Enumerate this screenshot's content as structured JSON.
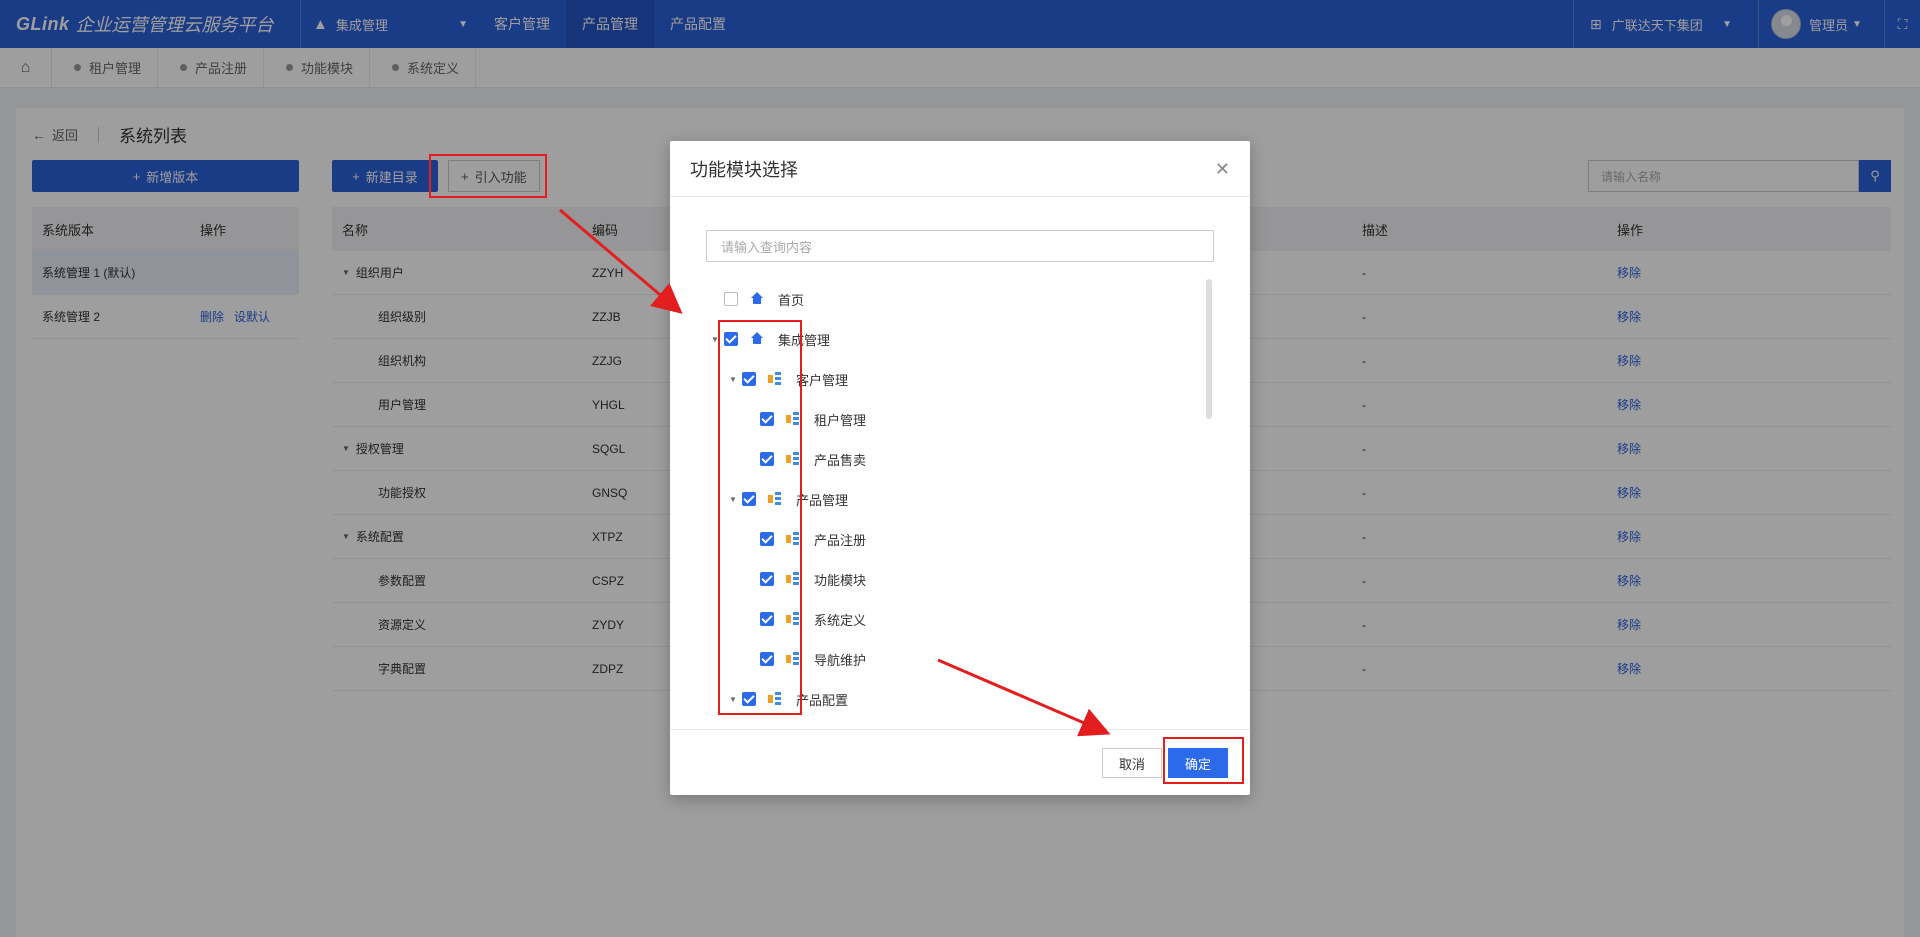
{
  "topbar": {
    "brand": "GLink",
    "title": "企业运营管理云服务平台",
    "system_menu": "集成管理",
    "tabs": [
      "客户管理",
      "产品管理",
      "产品配置"
    ],
    "org": "广联达天下集团",
    "user": "管理员"
  },
  "breadcrumbs": [
    "租户管理",
    "产品注册",
    "功能模块",
    "系统定义"
  ],
  "page": {
    "back": "返回",
    "title": "系统列表"
  },
  "left": {
    "add_version": "新增版本",
    "headers": [
      "系统版本",
      "操作"
    ],
    "rows": [
      {
        "name": "系统管理 1 (默认)",
        "actions": []
      },
      {
        "name": "系统管理 2",
        "actions": [
          "删除",
          "设默认"
        ]
      }
    ]
  },
  "right": {
    "new_dir": "新建目录",
    "import": "引入功能",
    "search_placeholder": "请输入名称",
    "headers": {
      "name": "名称",
      "code": "编码",
      "desc": "描述",
      "op": "操作"
    },
    "rows": [
      {
        "name": "组织用户",
        "code": "ZZYH",
        "desc": "-",
        "op": "移除",
        "parent": true
      },
      {
        "name": "组织级别",
        "code": "ZZJB",
        "desc": "-",
        "op": "移除",
        "parent": false
      },
      {
        "name": "组织机构",
        "code": "ZZJG",
        "desc": "-",
        "op": "移除",
        "parent": false
      },
      {
        "name": "用户管理",
        "code": "YHGL",
        "desc": "-",
        "op": "移除",
        "parent": false
      },
      {
        "name": "授权管理",
        "code": "SQGL",
        "desc": "-",
        "op": "移除",
        "parent": true
      },
      {
        "name": "功能授权",
        "code": "GNSQ",
        "desc": "-",
        "op": "移除",
        "parent": false
      },
      {
        "name": "系统配置",
        "code": "XTPZ",
        "desc": "-",
        "op": "移除",
        "parent": true
      },
      {
        "name": "参数配置",
        "code": "CSPZ",
        "desc": "-",
        "op": "移除",
        "parent": false
      },
      {
        "name": "资源定义",
        "code": "ZYDY",
        "desc": "-",
        "op": "移除",
        "parent": false
      },
      {
        "name": "字典配置",
        "code": "ZDPZ",
        "desc": "-",
        "op": "移除",
        "parent": false
      }
    ]
  },
  "modal": {
    "title": "功能模块选择",
    "search_placeholder": "请输入查询内容",
    "tree": [
      {
        "label": "首页",
        "level": 0,
        "checked": false,
        "expandable": false,
        "icon": "home-icon"
      },
      {
        "label": "集成管理",
        "level": 0,
        "checked": true,
        "expandable": true,
        "icon": "home-icon"
      },
      {
        "label": "客户管理",
        "level": 1,
        "checked": true,
        "expandable": true,
        "icon": "module-icon"
      },
      {
        "label": "租户管理",
        "level": 2,
        "checked": true,
        "expandable": false,
        "icon": "module-icon"
      },
      {
        "label": "产品售卖",
        "level": 2,
        "checked": true,
        "expandable": false,
        "icon": "module-icon"
      },
      {
        "label": "产品管理",
        "level": 1,
        "checked": true,
        "expandable": true,
        "icon": "module-icon"
      },
      {
        "label": "产品注册",
        "level": 2,
        "checked": true,
        "expandable": false,
        "icon": "module-icon"
      },
      {
        "label": "功能模块",
        "level": 2,
        "checked": true,
        "expandable": false,
        "icon": "module-icon"
      },
      {
        "label": "系统定义",
        "level": 2,
        "checked": true,
        "expandable": false,
        "icon": "module-icon"
      },
      {
        "label": "导航维护",
        "level": 2,
        "checked": true,
        "expandable": false,
        "icon": "module-icon"
      },
      {
        "label": "产品配置",
        "level": 1,
        "checked": true,
        "expandable": true,
        "icon": "module-icon"
      }
    ],
    "cancel": "取消",
    "ok": "确定"
  }
}
